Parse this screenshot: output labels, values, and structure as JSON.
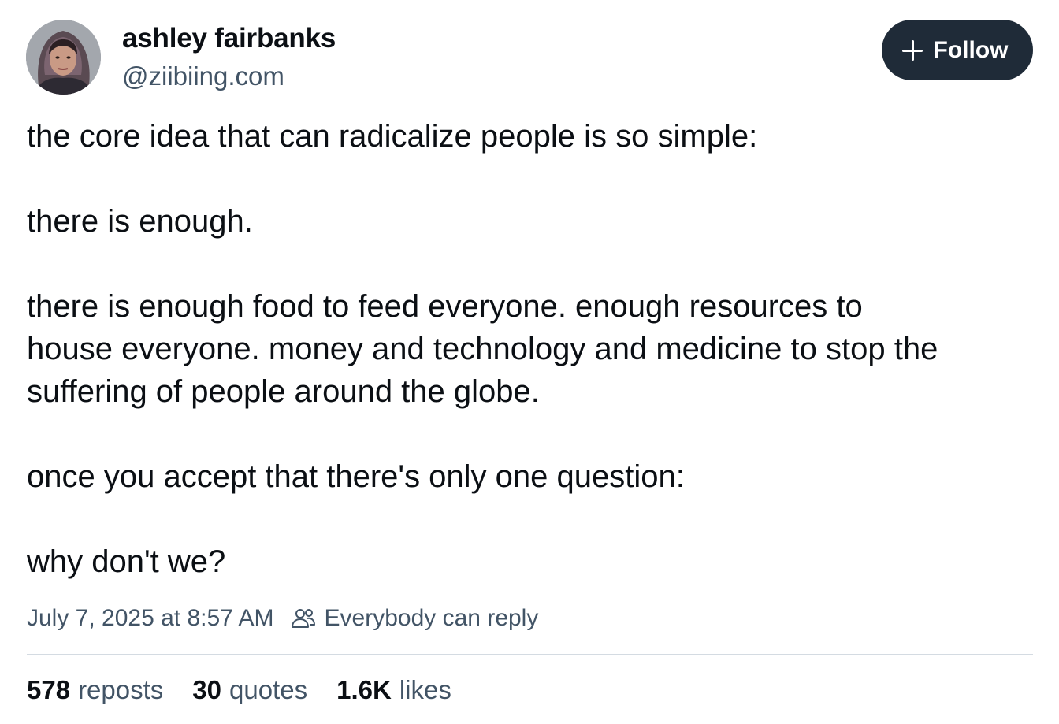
{
  "author": {
    "name": "ashley fairbanks",
    "handle": "@ziibiing.com",
    "avatar_icon": "profile-photo"
  },
  "follow_button": {
    "label": "Follow",
    "icon": "plus-icon",
    "background": "#1f2b38"
  },
  "post": {
    "paragraphs": [
      {
        "lines": [
          "the core idea that can radicalize people is so simple:"
        ]
      },
      {
        "lines": [
          "there is enough."
        ]
      },
      {
        "lines": [
          "there is enough food to feed everyone. enough resources to",
          "house everyone. money and technology and medicine to stop the",
          "suffering of people around the globe."
        ]
      },
      {
        "lines": [
          "once you accept that there's only one question:"
        ]
      },
      {
        "lines": [
          "why don't we?"
        ]
      }
    ]
  },
  "meta": {
    "timestamp": "July 7, 2025 at 8:57 AM",
    "reply_setting": "Everybody can reply",
    "reply_icon": "people-icon"
  },
  "stats": {
    "reposts": {
      "count": "578",
      "label": "reposts"
    },
    "quotes": {
      "count": "30",
      "label": "quotes"
    },
    "likes": {
      "count": "1.6K",
      "label": "likes"
    }
  },
  "colors": {
    "text_primary": "#0b0f14",
    "text_secondary": "#425466",
    "divider": "#d4dbe2"
  }
}
